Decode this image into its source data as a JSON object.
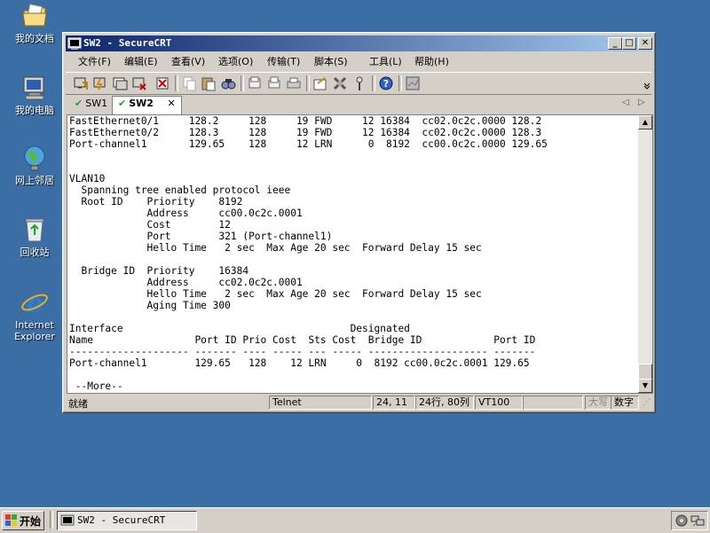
{
  "desktop": {
    "icons": [
      {
        "label": "我的文档"
      },
      {
        "label": "我的电脑"
      },
      {
        "label": "网上邻居"
      },
      {
        "label": "回收站"
      },
      {
        "label": "Internet Explorer"
      }
    ]
  },
  "window": {
    "title": "SW2 - SecureCRT",
    "menu": [
      "文件(F)",
      "编辑(E)",
      "查看(V)",
      "选项(O)",
      "传输(T)",
      "脚本(S)",
      "工具(L)",
      "帮助(H)"
    ],
    "tabs": [
      {
        "label": "SW1",
        "active": false
      },
      {
        "label": "SW2",
        "active": true
      }
    ],
    "terminal_lines": [
      "FastEthernet0/1     128.2     128     19 FWD     12 16384  cc02.0c2c.0000 128.2",
      "FastEthernet0/2     128.3     128     19 FWD     12 16384  cc02.0c2c.0000 128.3",
      "Port-channel1       129.65    128     12 LRN      0  8192  cc00.0c2c.0000 129.65",
      "",
      "",
      "VLAN10",
      "  Spanning tree enabled protocol ieee",
      "  Root ID    Priority    8192",
      "             Address     cc00.0c2c.0001",
      "             Cost        12",
      "             Port        321 (Port-channel1)",
      "             Hello Time   2 sec  Max Age 20 sec  Forward Delay 15 sec",
      "",
      "  Bridge ID  Priority    16384",
      "             Address     cc02.0c2c.0001",
      "             Hello Time   2 sec  Max Age 20 sec  Forward Delay 15 sec",
      "             Aging Time 300",
      "",
      "Interface                                      Designated",
      "Name                 Port ID Prio Cost  Sts Cost  Bridge ID            Port ID",
      "-------------------- ------- ---- ----- --- ----- -------------------- -------",
      "Port-channel1        129.65   128    12 LRN     0  8192 cc00.0c2c.0001 129.65",
      "",
      " --More--"
    ],
    "status": {
      "ready": "就绪",
      "protocol": "Telnet",
      "cursor": "24, 11",
      "size": "24行, 80列",
      "term": "VT100",
      "caps": "大写",
      "num": "数字"
    }
  },
  "taskbar": {
    "start": "开始",
    "task": "SW2 - SecureCRT"
  }
}
